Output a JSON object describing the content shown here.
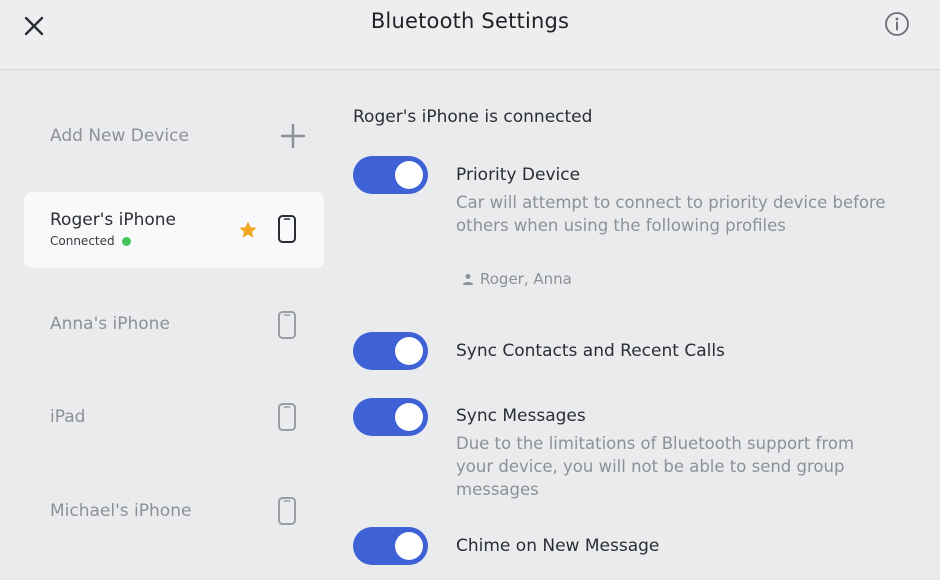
{
  "header": {
    "title": "Bluetooth Settings",
    "close_icon": "close-icon",
    "info_icon": "info-icon"
  },
  "sidebar": {
    "add_device_label": "Add New Device",
    "devices": [
      {
        "name": "Roger's iPhone",
        "status": "Connected",
        "priority": true,
        "active": true
      },
      {
        "name": "Anna's iPhone",
        "status": "",
        "priority": false,
        "active": false
      },
      {
        "name": "iPad",
        "status": "",
        "priority": false,
        "active": false
      },
      {
        "name": "Michael's iPhone",
        "status": "",
        "priority": false,
        "active": false
      }
    ]
  },
  "main": {
    "connected_title": "Roger's iPhone is connected",
    "settings": [
      {
        "title": "Priority Device",
        "description": "Car will attempt to connect to priority device before others when using the following profiles",
        "enabled": true
      },
      {
        "title": "Sync Contacts and Recent Calls",
        "description": "",
        "enabled": true
      },
      {
        "title": "Sync Messages",
        "description": "Due to the limitations of Bluetooth support from your device, you will not be able to send group messages",
        "enabled": true
      },
      {
        "title": "Chime on New Message",
        "description": "",
        "enabled": true
      }
    ],
    "priority_users": "Roger, Anna"
  },
  "colors": {
    "toggle_on": "#3e62d6",
    "star": "#f0a824",
    "connected_dot": "#43c45c",
    "background": "#e9ebed"
  }
}
